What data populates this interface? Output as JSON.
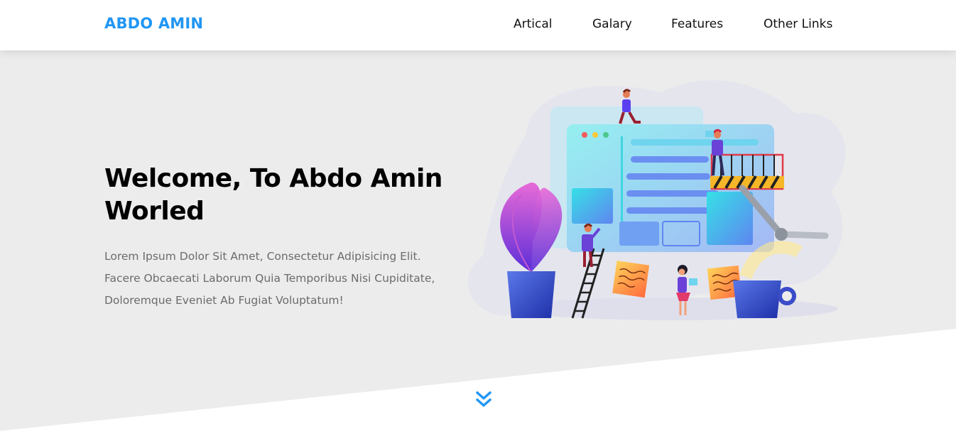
{
  "header": {
    "logo": "ABDO AMIN",
    "nav": [
      "Artical",
      "Galary",
      "Features",
      "Other Links"
    ]
  },
  "hero": {
    "title": "Welcome, To Abdo Amin Worled",
    "text": "Lorem Ipsum Dolor Sit Amet, Consectetur Adipisicing Elit. Facere Obcaecati Laborum Quia Temporibus Nisi Cupiditate, Doloremque Eveniet Ab Fugiat Voluptatum!"
  },
  "icons": {
    "scroll_down": "angle-double-down-icon"
  },
  "colors": {
    "brand": "#2196f3",
    "landing_bg": "#ececec",
    "heading": "#000000",
    "body_text": "#6b6b6b"
  }
}
